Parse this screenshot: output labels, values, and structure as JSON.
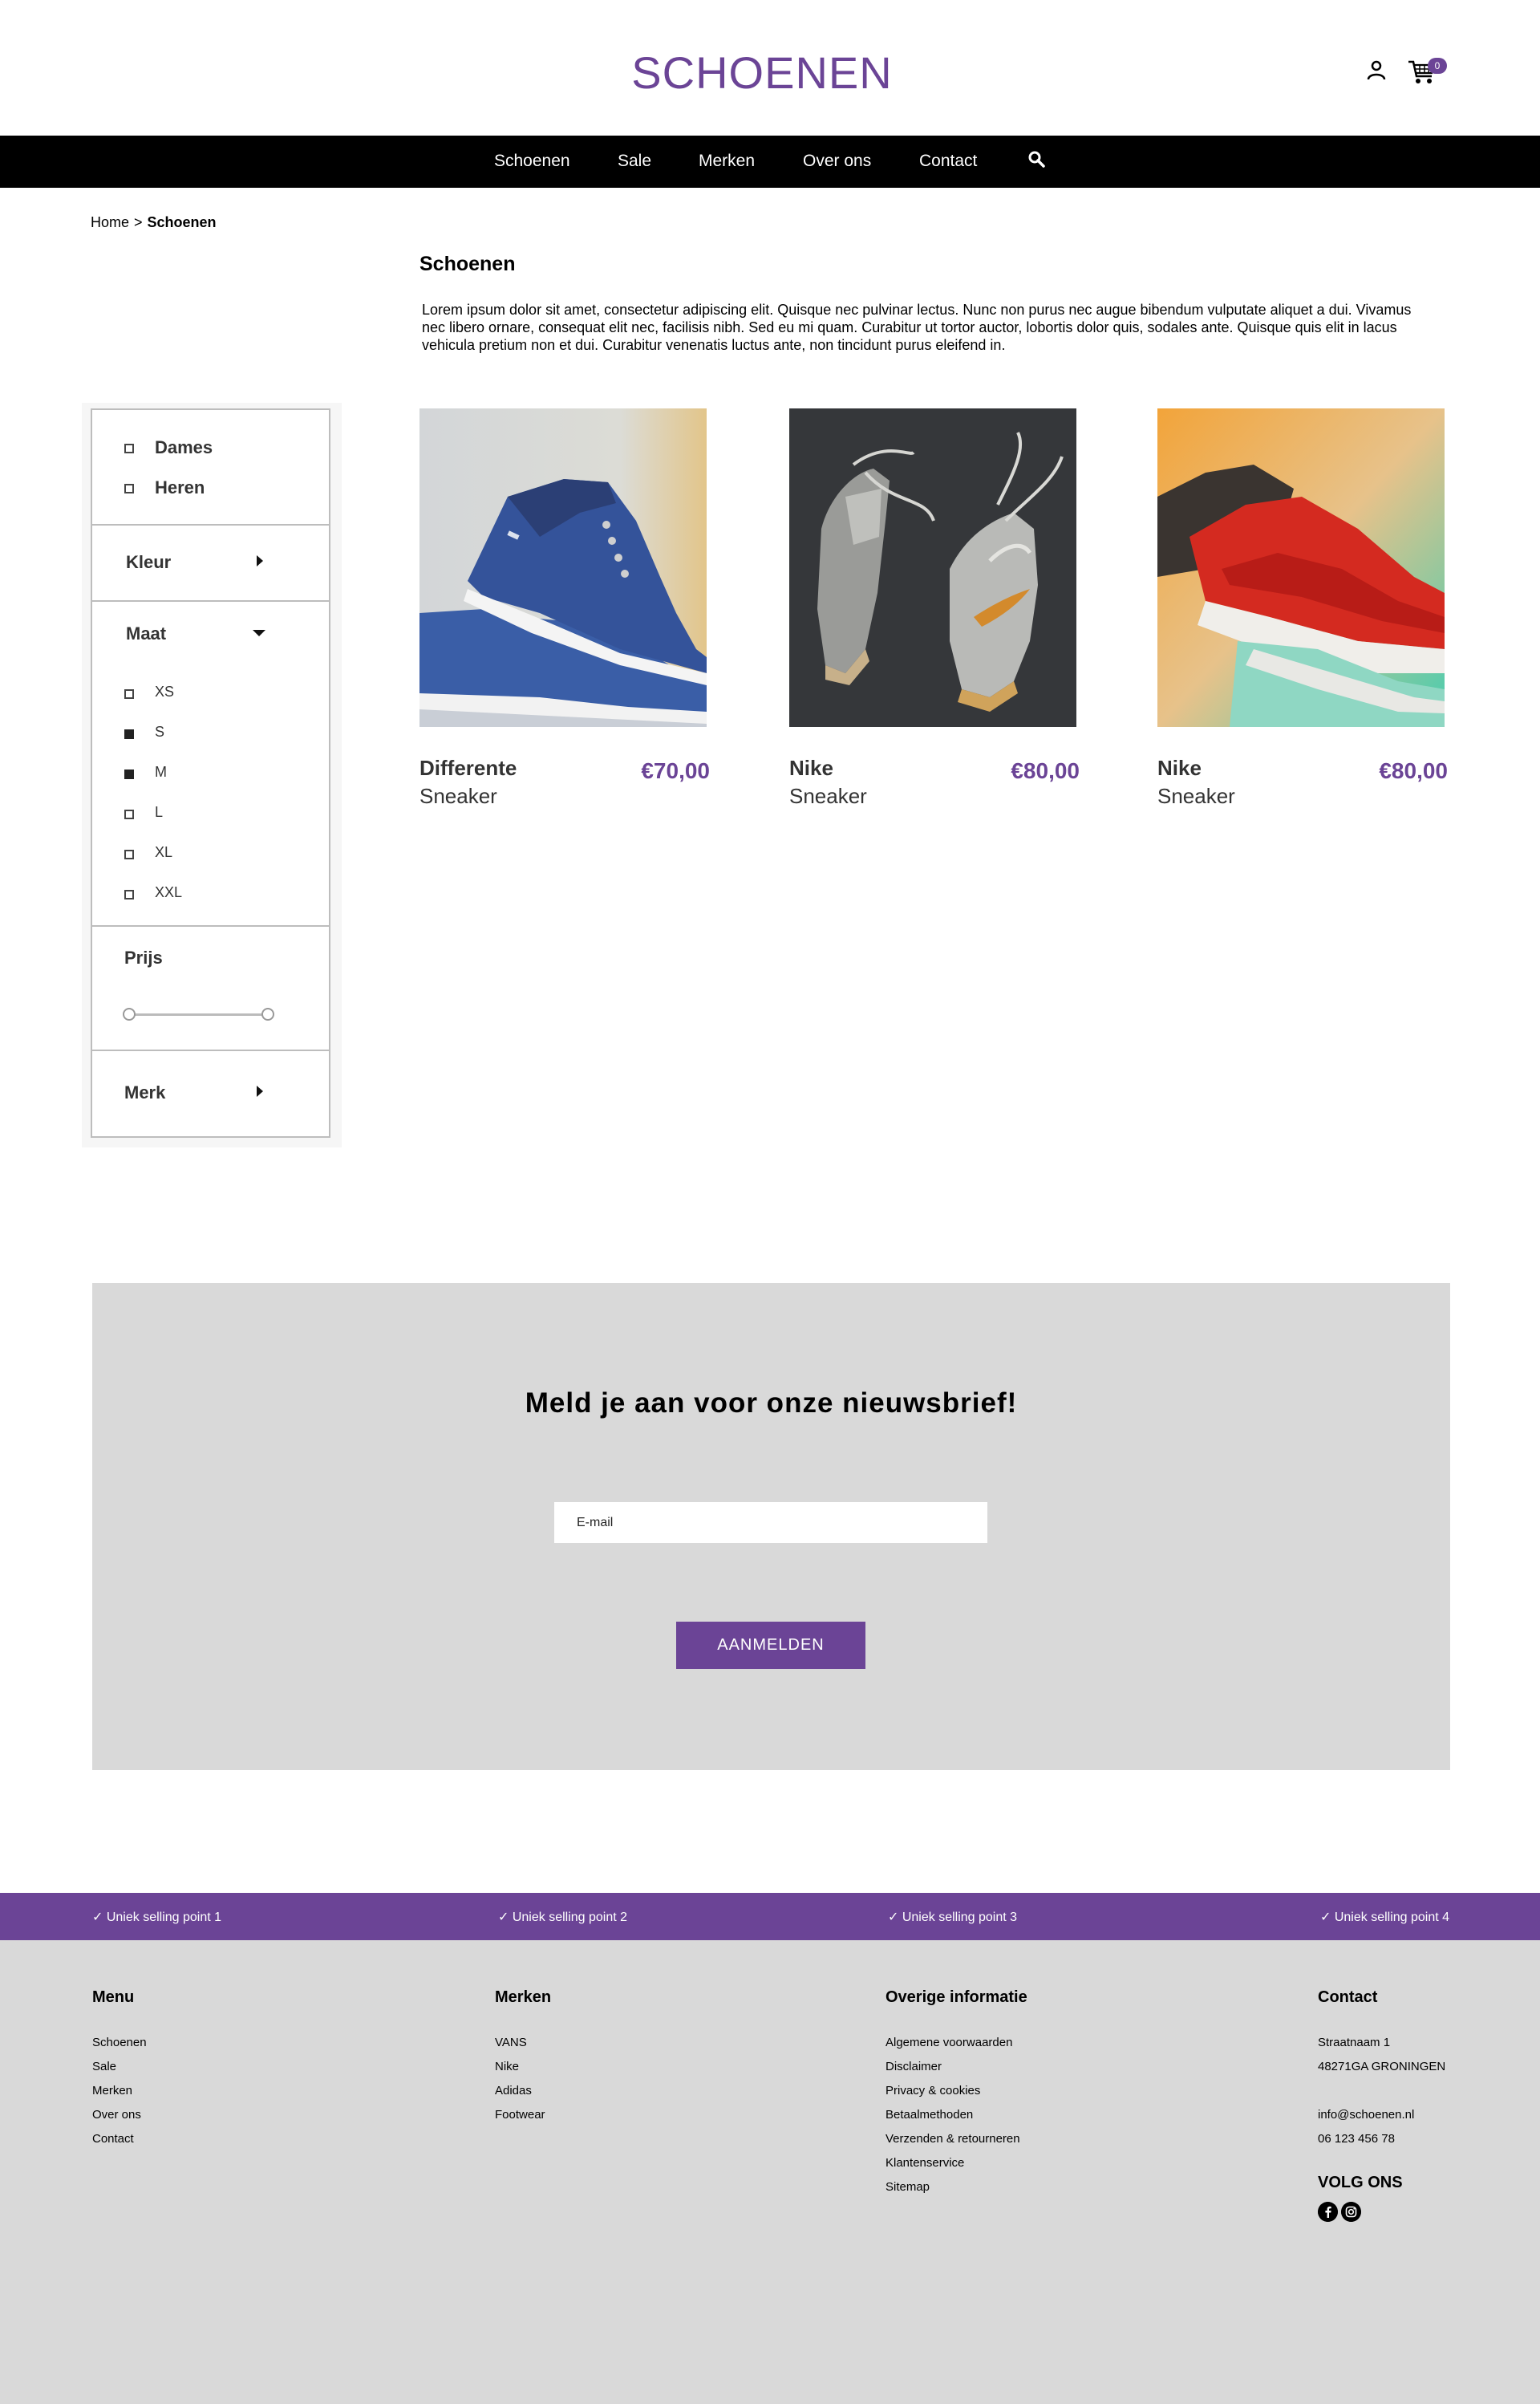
{
  "header": {
    "logo": "SCHOENEN",
    "cart_count": "0"
  },
  "nav": {
    "items": [
      "Schoenen",
      "Sale",
      "Merken",
      "Over ons",
      "Contact"
    ]
  },
  "breadcrumb": {
    "home": "Home",
    "separator": ">",
    "current": "Schoenen"
  },
  "intro": {
    "title": "Schoenen",
    "text": "Lorem ipsum dolor sit amet, consectetur adipiscing elit. Quisque nec pulvinar lectus. Nunc non purus nec augue bibendum vulputate aliquet a dui. Vivamus nec libero ornare, consequat elit nec, facilisis nibh. Sed eu mi quam. Curabitur ut tortor auctor, lobortis dolor quis, sodales ante. Quisque quis elit in lacus vehicula pretium non et dui. Curabitur venenatis luctus ante, non tincidunt purus eleifend in."
  },
  "filter": {
    "gender": [
      {
        "label": "Dames",
        "checked": false
      },
      {
        "label": "Heren",
        "checked": false
      }
    ],
    "color_heading": "Kleur",
    "size_heading": "Maat",
    "sizes": [
      {
        "label": "XS",
        "checked": false
      },
      {
        "label": "S",
        "checked": true
      },
      {
        "label": "M",
        "checked": true
      },
      {
        "label": "L",
        "checked": false
      },
      {
        "label": "XL",
        "checked": false
      },
      {
        "label": "XXL",
        "checked": false
      }
    ],
    "price_heading": "Prijs",
    "brand_heading": "Merk"
  },
  "products": [
    {
      "name": "Differente",
      "type": "Sneaker",
      "price": "€70,00"
    },
    {
      "name": "Nike",
      "type": "Sneaker",
      "price": "€80,00"
    },
    {
      "name": "Nike",
      "type": "Sneaker",
      "price": "€80,00"
    }
  ],
  "newsletter": {
    "title": "Meld je aan voor onze nieuwsbrief!",
    "placeholder": "E-mail",
    "button": "AANMELDEN"
  },
  "usps": [
    "✓ Uniek selling point 1",
    "✓ Uniek selling point 2",
    "✓ Uniek selling point 3",
    "✓ Uniek selling point 4"
  ],
  "footer": {
    "menu": {
      "title": "Menu",
      "links": [
        "Schoenen",
        "Sale",
        "Merken",
        "Over ons",
        "Contact"
      ]
    },
    "brands": {
      "title": "Merken",
      "links": [
        "VANS",
        "Nike",
        "Adidas",
        "Footwear"
      ]
    },
    "info": {
      "title": "Overige informatie",
      "links": [
        "Algemene voorwaarden",
        "Disclaimer",
        "Privacy & cookies",
        "Betaalmethoden",
        "Verzenden & retourneren",
        "Klantenservice",
        "Sitemap"
      ]
    },
    "contact": {
      "title": "Contact",
      "street": "Straatnaam 1",
      "city": "48271GA GRONINGEN",
      "email": "info@schoenen.nl",
      "phone": "06 123 456 78",
      "follow_title": "VOLG ONS"
    }
  },
  "colors": {
    "brand": "#6b4496",
    "nav_bg": "#000000",
    "panel_bg": "#d9d9d9"
  }
}
